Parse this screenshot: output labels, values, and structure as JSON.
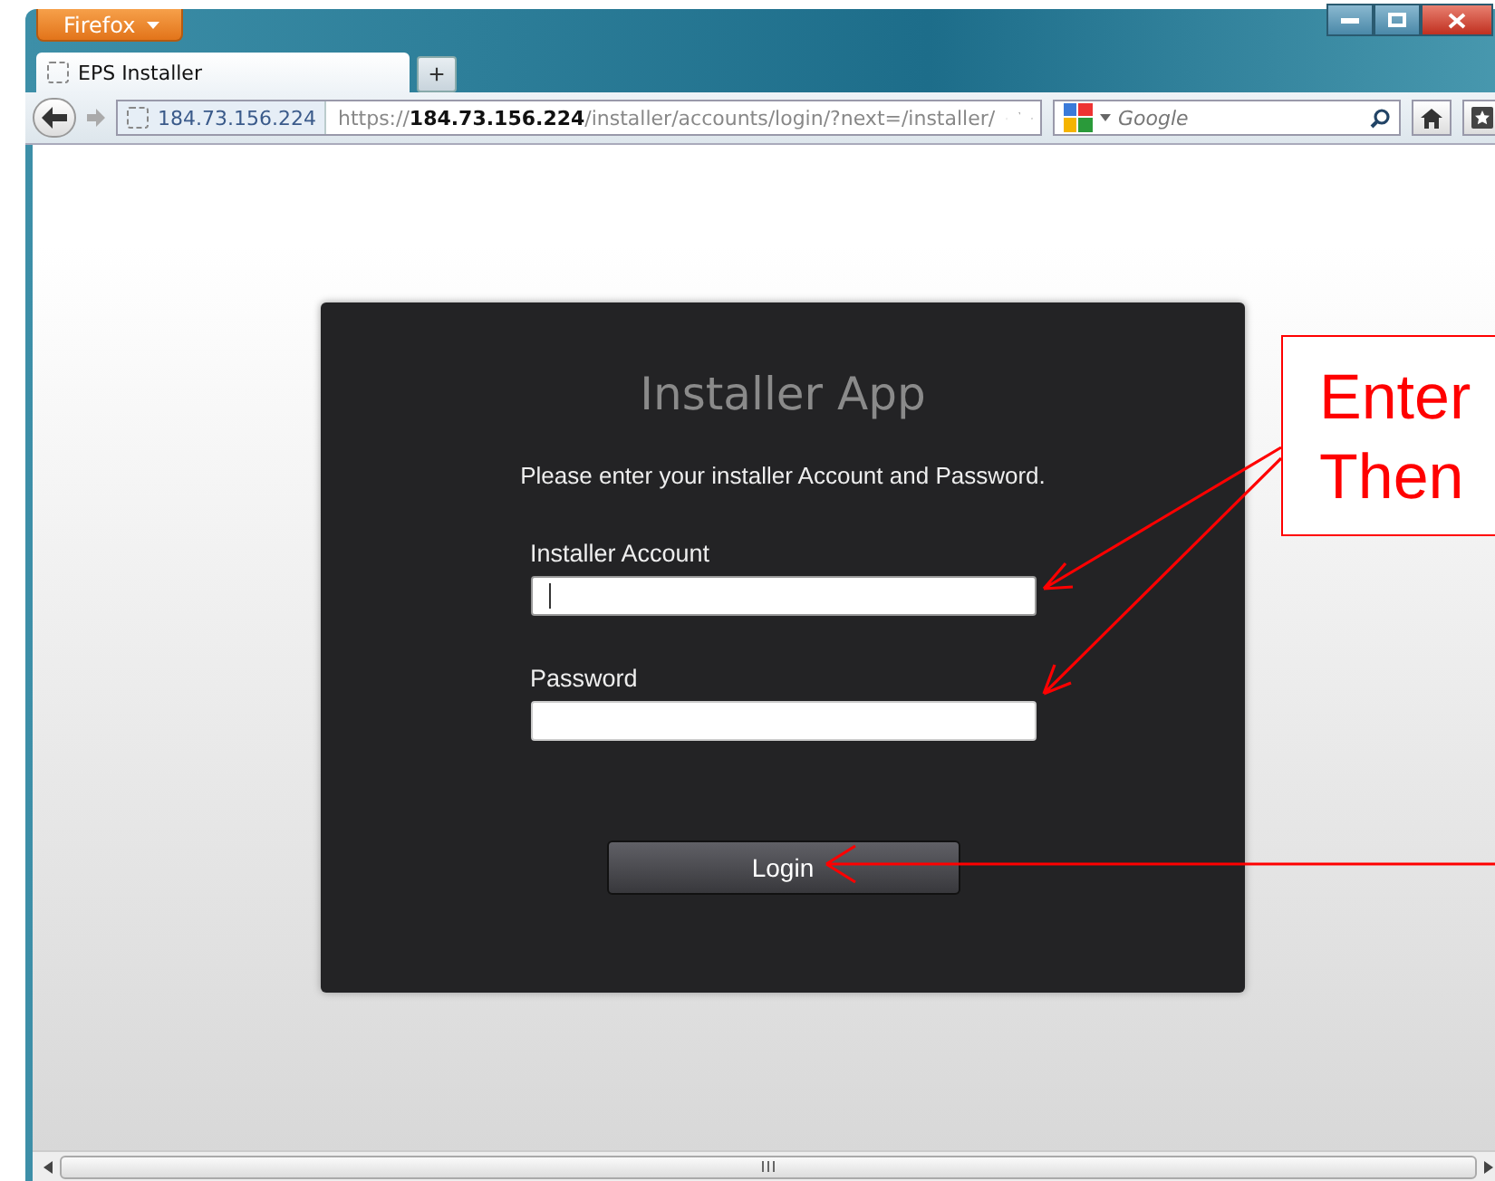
{
  "browser": {
    "menu_button": "Firefox",
    "tab_title": "EPS Installer",
    "new_tab": "+",
    "site_identity": "184.73.156.224",
    "url": "https://**184.73.156.224**/installer/accounts/login/?next=/installer/",
    "search_placeholder": "Google"
  },
  "login": {
    "title": "Installer App",
    "instruction": "Please enter your installer Account and Password.",
    "fields": [
      {
        "label": "Installer Account",
        "focused": true
      },
      {
        "label": "Password",
        "focused": false
      }
    ],
    "button": "Login"
  },
  "callout": {
    "lines": [
      "Enter",
      "Then"
    ]
  }
}
